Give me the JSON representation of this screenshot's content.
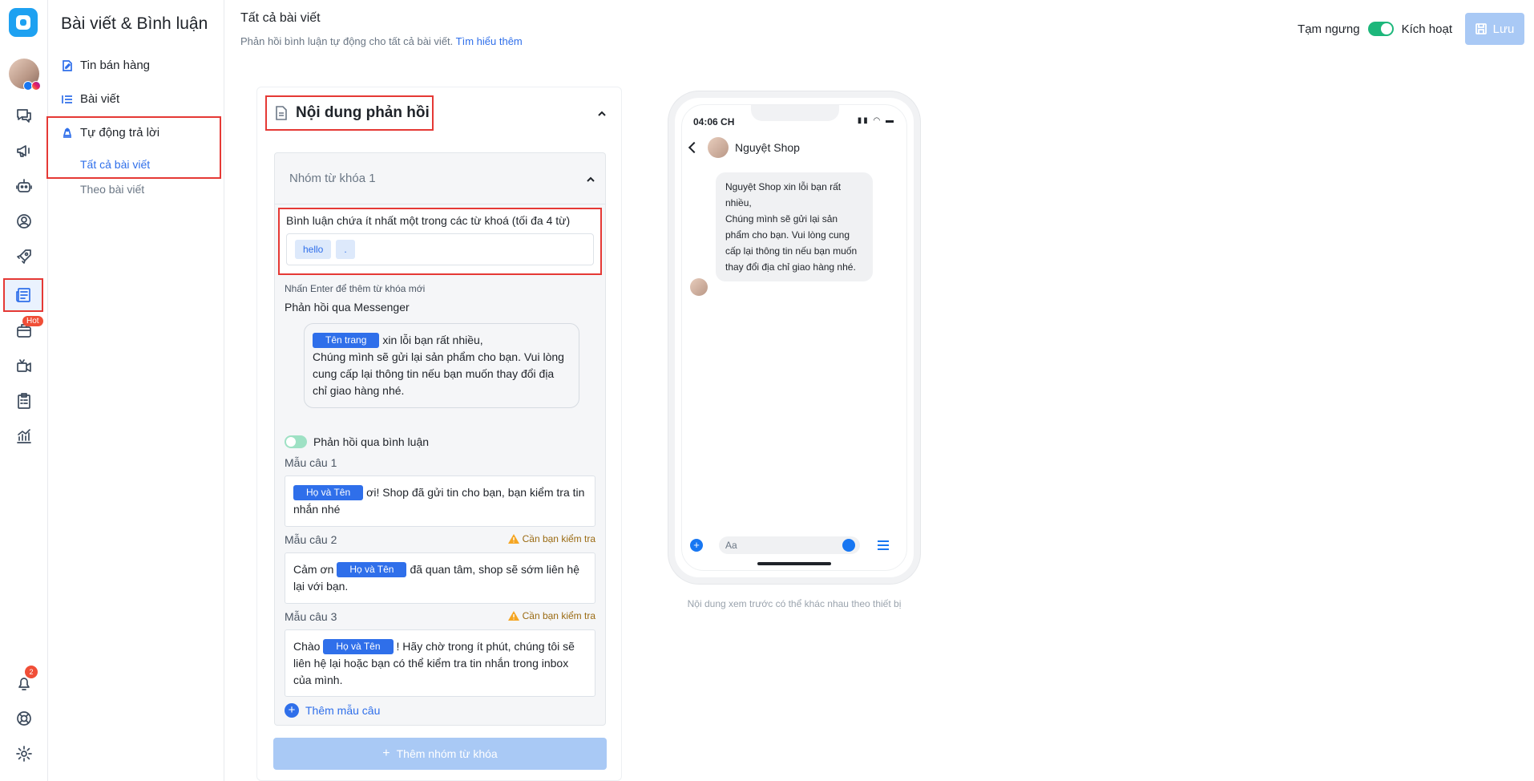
{
  "submenu": {
    "title": "Bài viết & Bình luận",
    "items": [
      {
        "label": "Tin bán hàng",
        "icon": "edit-icon"
      },
      {
        "label": "Bài viết",
        "icon": "list-icon"
      },
      {
        "label": "Tự động trả lời",
        "icon": "auto-reply-icon"
      }
    ],
    "sub_items": [
      "Tất cả bài viết",
      "Theo bài viết"
    ]
  },
  "rail": {
    "hot_badge": "Hot",
    "notification_count": "2",
    "accent_color": "#2f6fea"
  },
  "header": {
    "title": "Tất cả bài viết",
    "subtitle": "Phản hồi bình luận tự động cho tất cả bài viết.",
    "learn_more": "Tìm hiểu thêm",
    "pause_label": "Tạm ngưng",
    "activate_label": "Kích hoạt",
    "save_label": "Lưu"
  },
  "panel": {
    "title": "Nội dung phản hồi",
    "group_title": "Nhóm từ khóa 1",
    "keyword_label": "Bình luận chứa ít nhất một trong các từ khoá (tối đa 4 từ)",
    "keywords": [
      "hello",
      "."
    ],
    "keyword_hint": "Nhấn Enter để thêm từ khóa mới",
    "messenger_label": "Phản hồi qua Messenger",
    "messenger_tag": "Tên trang",
    "messenger_text": "xin lỗi bạn rất nhiều,",
    "messenger_text2": "Chúng mình sẽ gửi lại sản phẩm cho bạn. Vui lòng cung cấp lại thông tin nếu bạn muốn thay đổi địa chỉ giao hàng nhé.",
    "comment_label": "Phản hồi qua bình luận",
    "warning_label": "Cần bạn kiểm tra",
    "name_tag": "Họ và Tên",
    "templates": [
      {
        "label": "Mẫu câu 1",
        "before": "",
        "after": "ơi! Shop đã gửi tin cho bạn, bạn kiểm tra tin nhắn nhé"
      },
      {
        "label": "Mẫu câu 2",
        "before": "Cảm ơn",
        "after": "đã quan tâm, shop sẽ sớm liên hệ lại với bạn."
      },
      {
        "label": "Mẫu câu 3",
        "before": "Chào",
        "after": "! Hãy chờ trong ít phút, chúng tôi sẽ liên hệ lại hoặc bạn có thể kiểm tra tin nhắn trong inbox của mình."
      }
    ],
    "add_template": "Thêm mẫu câu",
    "add_group": "Thêm nhóm từ khóa"
  },
  "preview": {
    "time": "04:06 CH",
    "shop_name": "Nguyệt Shop",
    "message": "Nguyệt Shop xin lỗi bạn rất nhiều,\nChúng mình sẽ gửi lại sản phẩm cho bạn. Vui lòng cung cấp lại thông tin nếu bạn muốn thay đổi địa chỉ giao hàng nhé.",
    "composer_placeholder": "Aa",
    "note": "Nội dung xem trước có thể khác nhau theo thiết bị"
  }
}
